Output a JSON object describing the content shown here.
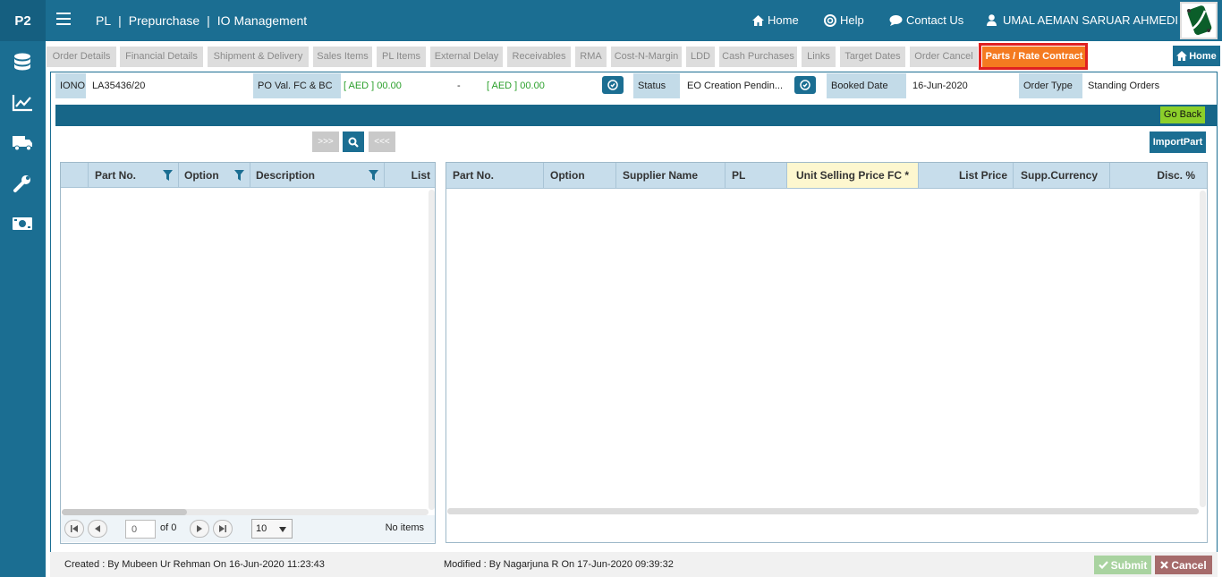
{
  "app": {
    "logo": "P2"
  },
  "breadcrumb": [
    "PL",
    "Prepurchase",
    "IO Management"
  ],
  "nav": {
    "home": "Home",
    "help": "Help",
    "contact": "Contact Us",
    "user": "UMAL AEMAN SARUAR AHMEDI"
  },
  "sidebar": {
    "items": [
      "database-icon",
      "chart-line-icon",
      "truck-icon",
      "wrench-icon",
      "money-icon"
    ]
  },
  "tabs": [
    {
      "label": "Order Details"
    },
    {
      "label": "Financial Details"
    },
    {
      "label": "Shipment & Delivery"
    },
    {
      "label": "Sales Items"
    },
    {
      "label": "PL Items"
    },
    {
      "label": "External Delay"
    },
    {
      "label": "Receivables"
    },
    {
      "label": "RMA"
    },
    {
      "label": "Cost-N-Margin"
    },
    {
      "label": "LDD"
    },
    {
      "label": "Cash Purchases"
    },
    {
      "label": "Links"
    },
    {
      "label": "Target Dates"
    },
    {
      "label": "Order Cancel"
    },
    {
      "label": "Parts / Rate Contract",
      "active": true
    }
  ],
  "home_button": "Home",
  "info": {
    "iono_label": "IONO",
    "iono_value": "LA35436/20",
    "po_label": "PO Val. FC & BC",
    "po_fc": "[ AED ] 00.00",
    "po_dash": "-",
    "po_bc": "[ AED ] 00.00",
    "status_label": "Status",
    "status_value": "EO Creation Pendin...",
    "booked_label": "Booked Date",
    "booked_value": "16-Jun-2020",
    "ordertype_label": "Order Type",
    "ordertype_value": "Standing Orders"
  },
  "go_back": "Go Back",
  "transfer": {
    "forward": ">>>",
    "back": "<<<"
  },
  "import_part": "ImportPart",
  "left_grid": {
    "columns": [
      "Part No.",
      "Option",
      "Description",
      "List"
    ],
    "pager": {
      "page": "0",
      "of": "of 0",
      "page_size": "10",
      "empty": "No items"
    }
  },
  "right_grid": {
    "columns": [
      "Part No.",
      "Option",
      "Supplier Name",
      "PL",
      "Unit Selling Price FC *",
      "List Price",
      "Supp.Currency",
      "Disc. %"
    ]
  },
  "footer": {
    "created": "Created : By Mubeen Ur Rehman On 16-Jun-2020 11:23:43",
    "modified": "Modified : By Nagarjuna R On 17-Jun-2020 09:39:32",
    "submit": "Submit",
    "cancel": "Cancel"
  },
  "colors": {
    "primary": "#1b6e92",
    "active_tab": "#f47a20",
    "highlight": "#e02020",
    "value_green": "#2ca02c",
    "go_back": "#8ccf2a"
  }
}
